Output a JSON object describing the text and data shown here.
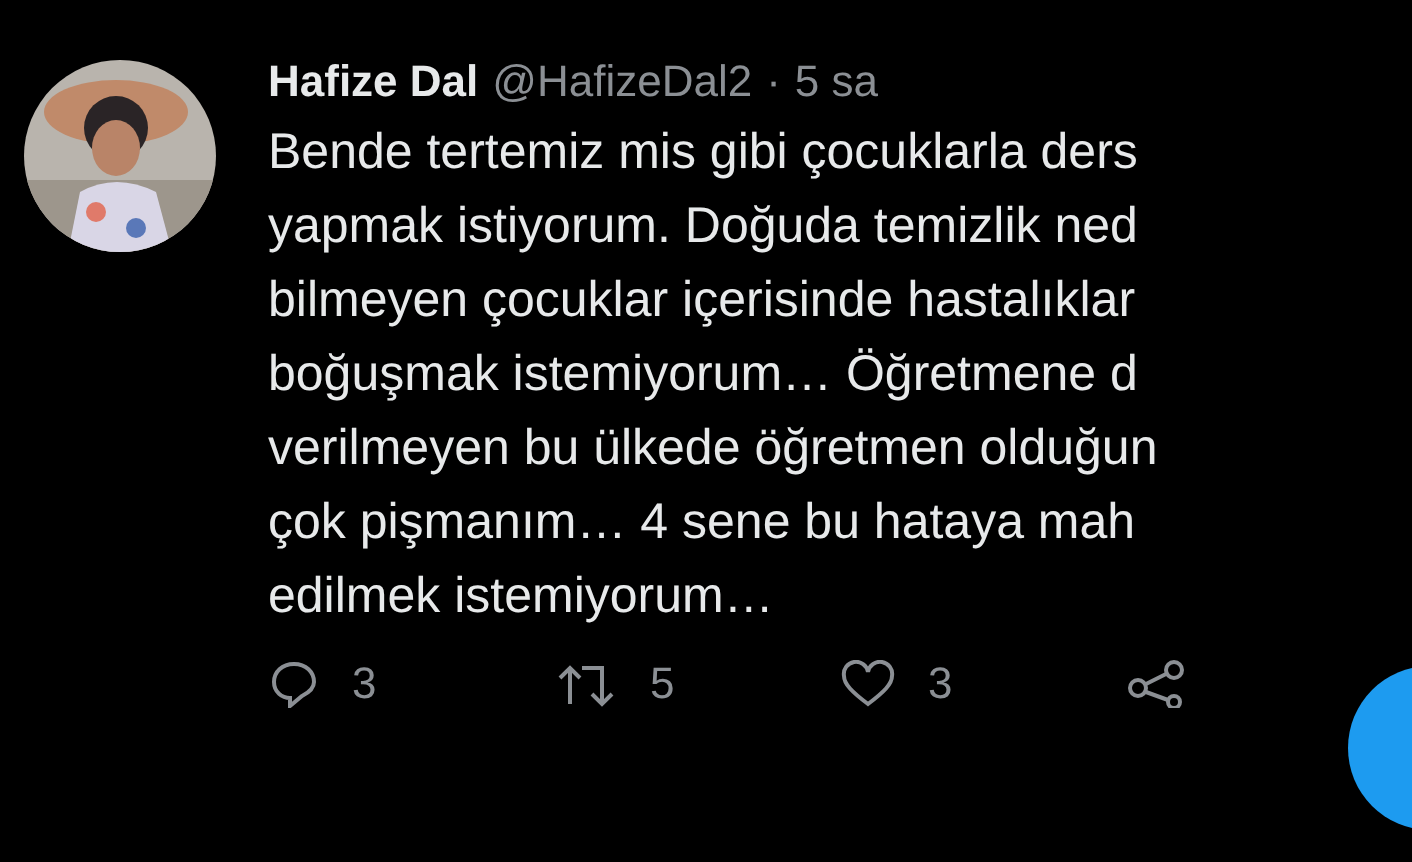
{
  "tweet": {
    "name": "Hafize Dal",
    "handle": "@HafizeDal2",
    "separator": "·",
    "time": "5 sa",
    "lines": [
      "Bende tertemiz mis gibi çocuklarla ders",
      "yapmak istiyorum. Doğuda temizlik ned",
      "bilmeyen çocuklar içerisinde hastalıklar",
      "boğuşmak istemiyorum… Öğretmene d",
      "verilmeyen bu ülkede öğretmen olduğun",
      "çok pişmanım… 4 sene bu hataya mah",
      "edilmek istemiyorum…"
    ],
    "actions": [
      {
        "kind": "reply",
        "count": "3"
      },
      {
        "kind": "retweet",
        "count": "5"
      },
      {
        "kind": "like",
        "count": "3"
      },
      {
        "kind": "share"
      }
    ]
  }
}
